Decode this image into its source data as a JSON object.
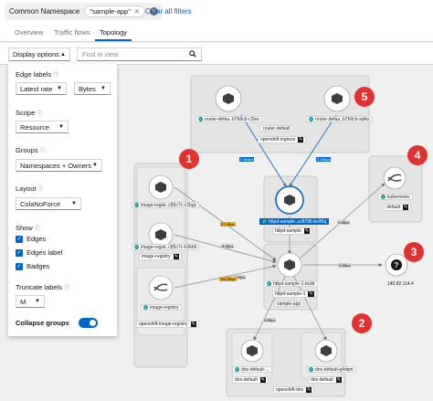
{
  "filter": {
    "group_label": "Common Namespace",
    "chip_value": "\"sample-app\"",
    "clear_label": "Clear all filters"
  },
  "tabs": [
    {
      "label": "Overview"
    },
    {
      "label": "Traffic flows"
    },
    {
      "label": "Topology",
      "active": true
    }
  ],
  "toolbar": {
    "display_options_label": "Display options",
    "find_placeholder": "Find in view"
  },
  "panel": {
    "edge_labels_title": "Edge labels",
    "edge_label_value": "Latest rate",
    "edge_unit_value": "Bytes",
    "scope_title": "Scope",
    "scope_value": "Resource",
    "groups_title": "Groups",
    "groups_value": "Namespaces + Owners",
    "layout_title": "Layout",
    "layout_value": "ColaNoForce",
    "show_title": "Show",
    "show_items": [
      {
        "label": "Edges",
        "checked": true
      },
      {
        "label": "Edges label",
        "checked": true
      },
      {
        "label": "Badges",
        "checked": true
      }
    ],
    "truncate_title": "Truncate labels",
    "truncate_value": "M",
    "collapse_label": "Collapse groups",
    "collapse_on": true
  },
  "callouts": [
    "1",
    "2",
    "3",
    "4",
    "5"
  ],
  "nodes": {
    "router_left": "router-defau..b7b9cb-c2lee",
    "router_right": "router-defau..b7b9cb-xplkx",
    "router_default": "router-default",
    "openshift_ingress": "openshift-ingress",
    "image_reg_1": "image-regist..c85c7c-c2bgx",
    "image_reg_2": "image-regist..c85c7c-h2kh6",
    "image_registry": "image-registry",
    "image_registry_2": "image-registry",
    "openshift_image_registry": "openshift-image-registry",
    "httpd_sample_pod": "httpd-sample..cc8796-bv95q",
    "httpd_sample": "httpd-sample",
    "httpd_build": "httpd-sample-1-build",
    "httpd_sample_1": "httpd-sample-1",
    "sample_app": "sample-app",
    "kubernetes": "kubernetes",
    "default_ns": "default",
    "ip_address": "140.82.114.4",
    "dns_left": "dns-default-...",
    "dns_right": "dns-default-g4dqm",
    "dns_default_l": "dns-default",
    "dns_default_r": "dns-default",
    "openshift_dns": "openshift-dns"
  },
  "rates": {
    "r1": "37.4Bps",
    "r2": "8.4Bps",
    "r3": "8.4Bps",
    "r4": "160.5Bps",
    "r5": "0.6Bps",
    "r6": "0.6Bps",
    "r7": "0.8Bps",
    "r8": "2.5kBps",
    "r9": "3.2kBps"
  },
  "colors": {
    "accent": "#0066cc",
    "callout": "#e0322f",
    "badge": "#009596",
    "rate_highlight": "#f0ab00"
  }
}
